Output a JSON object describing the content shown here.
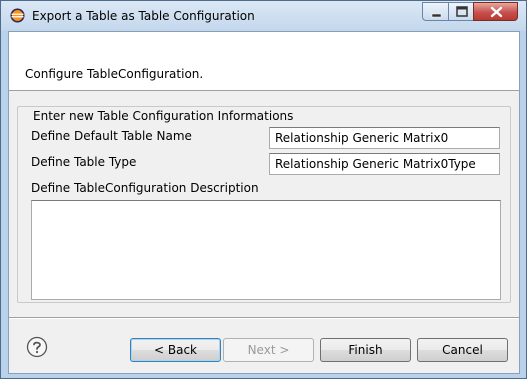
{
  "window": {
    "title": "Export a Table as Table Configuration"
  },
  "header": {
    "message": "Configure TableConfiguration."
  },
  "group": {
    "title": "Enter new Table Configuration Informations",
    "name_label": "Define Default Table Name",
    "name_value": "Relationship Generic Matrix0",
    "type_label": "Define Table Type",
    "type_value": "Relationship Generic Matrix0Type",
    "description_label": "Define TableConfiguration Description",
    "description_value": ""
  },
  "buttons": {
    "back": "< Back",
    "next": "Next >",
    "finish": "Finish",
    "cancel": "Cancel"
  },
  "icons": {
    "app": "eclipse-icon",
    "help": "help-icon",
    "minimize": "minimize-icon",
    "maximize": "maximize-icon",
    "close": "close-icon"
  },
  "colors": {
    "titlebar": "#c3d7ec",
    "dialog_bg": "#f0f0f0",
    "close_button": "#c75050",
    "default_button_border": "#3c7fb1"
  }
}
